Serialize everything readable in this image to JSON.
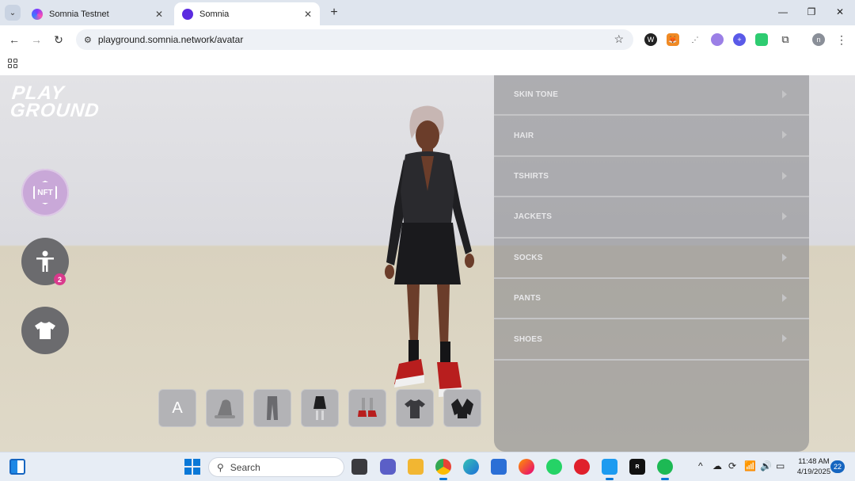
{
  "browser": {
    "tabs": [
      {
        "title": "Somnia Testnet",
        "active": false
      },
      {
        "title": "Somnia",
        "active": true
      }
    ],
    "url": "playground.somnia.network/avatar"
  },
  "app": {
    "logo": {
      "line1": "PLAY",
      "line2": "GROUND"
    },
    "side_buttons": [
      {
        "label": "NFT",
        "icon": "nft-hexagon-icon"
      },
      {
        "icon": "accessibility-person-icon",
        "badge": "2"
      },
      {
        "icon": "tshirt-icon"
      }
    ],
    "categories": [
      {
        "label": "SKIN TONE"
      },
      {
        "label": "HAIR"
      },
      {
        "label": "TSHIRTS"
      },
      {
        "label": "JACKETS"
      },
      {
        "label": "SOCKS"
      },
      {
        "label": "PANTS"
      },
      {
        "label": "SHOES"
      }
    ],
    "thumbnails": [
      {
        "label": "A",
        "icon": "skin-tone-letter"
      },
      {
        "icon": "hair-icon"
      },
      {
        "icon": "pants-icon"
      },
      {
        "icon": "skirt-icon"
      },
      {
        "icon": "shoes-icon"
      },
      {
        "icon": "tshirt-icon"
      },
      {
        "icon": "jacket-icon"
      }
    ],
    "colors": {
      "panel": "#8c8c90",
      "badge": "#d93a8c",
      "nft_button": "#c9a8d8"
    }
  },
  "taskbar": {
    "search_placeholder": "Search",
    "time": "11:48 AM",
    "date": "4/19/2025",
    "notifications": "22"
  }
}
